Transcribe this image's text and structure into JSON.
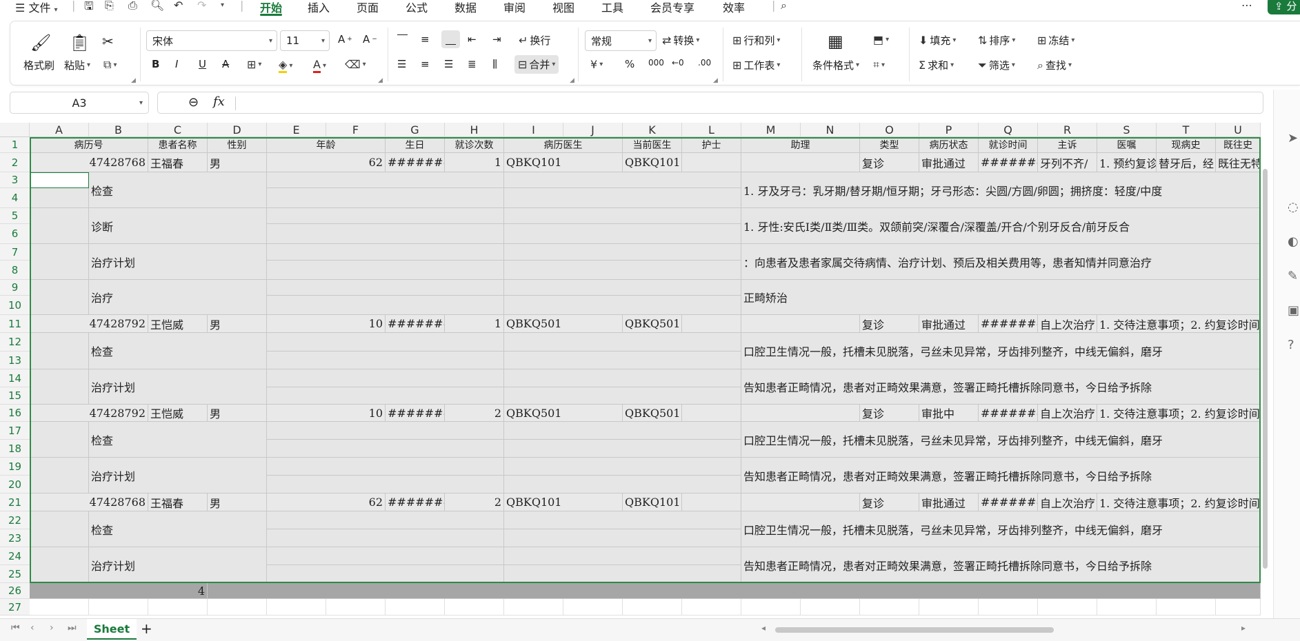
{
  "menu": {
    "file": "文件",
    "tabs": [
      "开始",
      "插入",
      "页面",
      "公式",
      "数据",
      "审阅",
      "视图",
      "工具",
      "会员专享",
      "效率"
    ],
    "share": "分"
  },
  "ribbon": {
    "format_painter": "格式刷",
    "paste": "粘贴",
    "font_name": "宋体",
    "font_size": "11",
    "wrap": "换行",
    "merge": "合并",
    "number_format": "常规",
    "convert": "转换",
    "rows_cols": "行和列",
    "worksheet": "工作表",
    "cond_format": "条件格式",
    "fill": "填充",
    "sort": "排序",
    "freeze": "冻结",
    "sum": "求和",
    "filter": "筛选",
    "find": "查找"
  },
  "formula": {
    "name_box": "A3",
    "fx": "fx",
    "value": ""
  },
  "columns": [
    "A",
    "B",
    "C",
    "D",
    "E",
    "F",
    "G",
    "H",
    "I",
    "J",
    "K",
    "L",
    "M",
    "N",
    "O",
    "P",
    "Q",
    "R",
    "S",
    "T",
    "U"
  ],
  "rows": [
    "1",
    "2",
    "3",
    "4",
    "5",
    "6",
    "7",
    "8",
    "9",
    "10",
    "11",
    "12",
    "13",
    "14",
    "15",
    "16",
    "17",
    "18",
    "19",
    "20",
    "21",
    "22",
    "23",
    "24",
    "25",
    "26",
    "27"
  ],
  "headers": {
    "A": "病历号",
    "C": "患者名称",
    "D": "性别",
    "E": "年龄",
    "G": "生日",
    "H": "就诊次数",
    "I": "病历医生",
    "K": "当前医生",
    "L": "护士",
    "M": "助理",
    "O": "类型",
    "P": "病历状态",
    "Q": "就诊时间",
    "R": "主诉",
    "S": "医嘱",
    "T": "现病史",
    "U": "既往史"
  },
  "records": [
    {
      "id": "47428768",
      "name": "王福春",
      "sex": "男",
      "age": "62",
      "birthday": "########",
      "visits": "1",
      "doctor": "QBKQ101",
      "current": "QBKQ101",
      "type": "复诊",
      "status": "审批通过",
      "time": "########",
      "complaint": "牙列不齐/",
      "advice": "1. 预约复诊",
      "history": "替牙后，经",
      "past": "既往无特"
    },
    {
      "id": "47428792",
      "name": "王恺威",
      "sex": "男",
      "age": "10",
      "birthday": "########",
      "visits": "1",
      "doctor": "QBKQ501",
      "current": "QBKQ501",
      "type": "复诊",
      "status": "审批通过",
      "time": "########",
      "complaint": "自上次治疗",
      "advice": "1. 交待注意事项；2. 约复诊时间"
    },
    {
      "id": "47428792",
      "name": "王恺威",
      "sex": "男",
      "age": "10",
      "birthday": "########",
      "visits": "2",
      "doctor": "QBKQ501",
      "current": "QBKQ501",
      "type": "复诊",
      "status": "审批中",
      "time": "########",
      "complaint": "自上次治疗",
      "advice": "1. 交待注意事项；2. 约复诊时间"
    },
    {
      "id": "47428768",
      "name": "王福春",
      "sex": "男",
      "age": "62",
      "birthday": "########",
      "visits": "2",
      "doctor": "QBKQ101",
      "current": "QBKQ101",
      "type": "复诊",
      "status": "审批通过",
      "time": "########",
      "complaint": "自上次治疗",
      "advice": "1. 交待注意事项；2. 约复诊时间"
    }
  ],
  "details": {
    "exam": "检查",
    "diagnosis": "诊断",
    "plan": "治疗计划",
    "treatment": "治疗",
    "r1_exam": "1. 牙及牙弓：乳牙期/替牙期/恒牙期；牙弓形态：尖圆/方圆/卵圆；拥挤度：轻度/中度",
    "r1_diag": "1. 牙性:安氏Ⅰ类/Ⅱ类/Ⅲ类。双颌前突/深覆合/深覆盖/开合/个别牙反合/前牙反合",
    "r1_plan": "：向患者及患者家属交待病情、治疗计划、预后及相关费用等，患者知情并同意治疗",
    "r1_treat": "正畸矫治",
    "exam_text": "口腔卫生情况一般，托槽未见脱落，弓丝未见异常，牙齿排列整齐，中线无偏斜，磨牙",
    "plan_text": "告知患者正畸情况，患者对正畸效果满意，签署正畸托槽拆除同意书，今日给予拆除"
  },
  "count_value": "4",
  "sheet_tab": "Sheet"
}
